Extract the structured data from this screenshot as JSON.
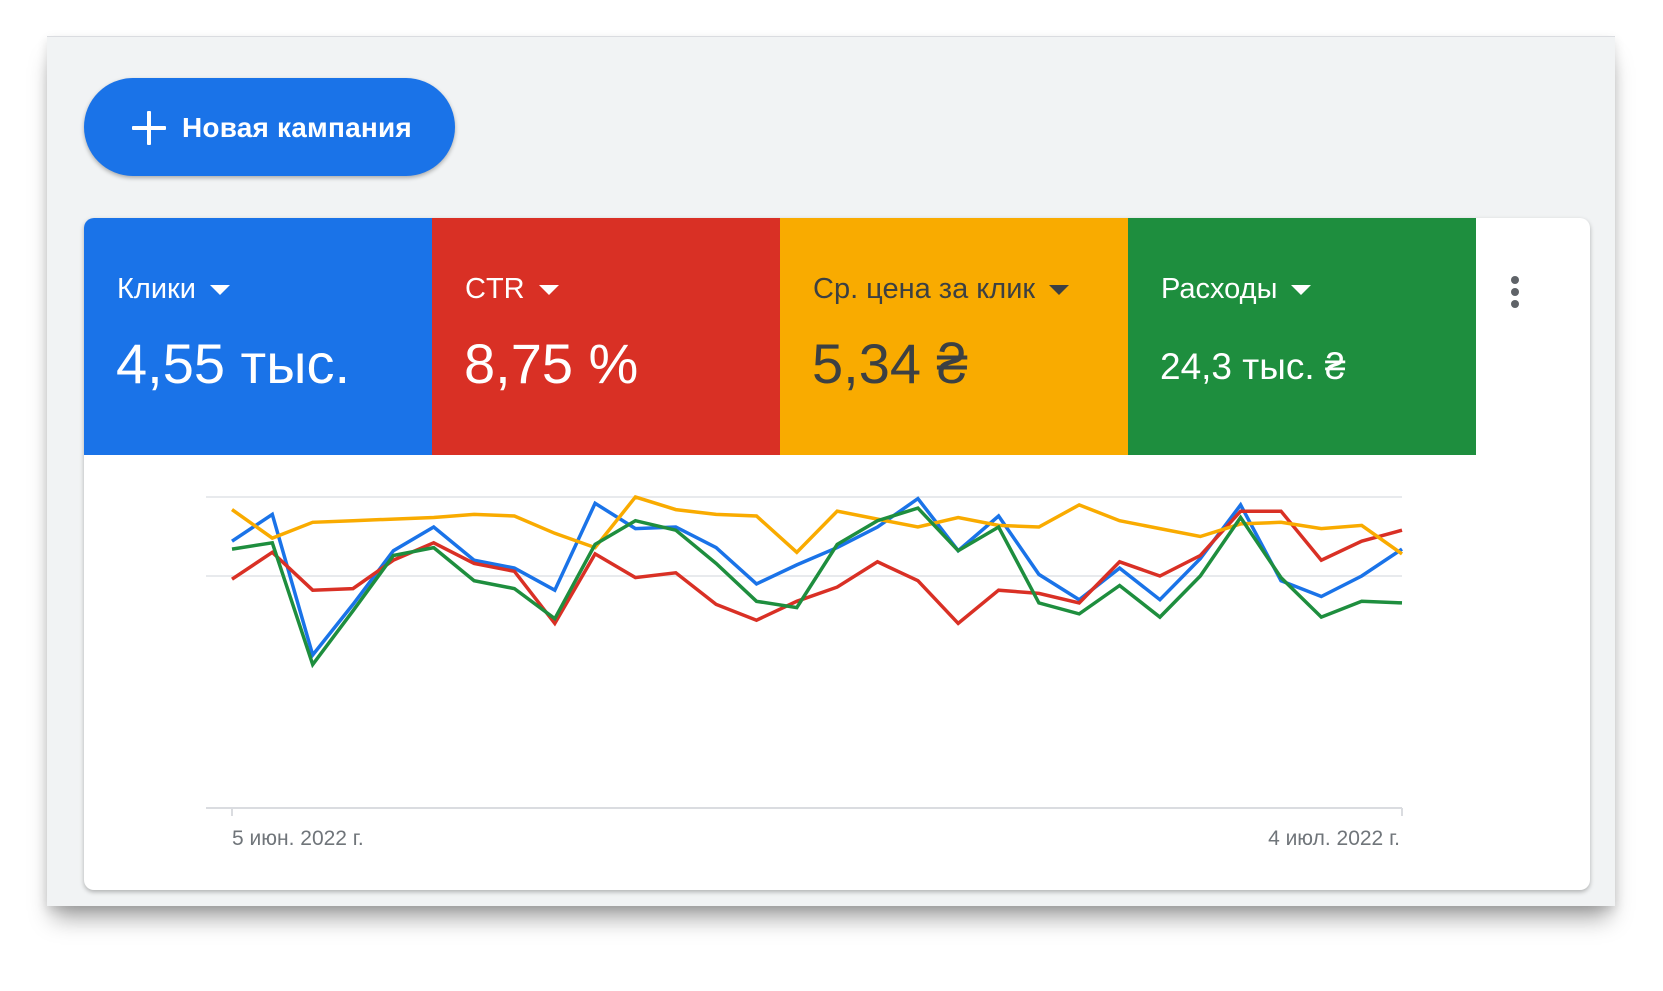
{
  "toolbar": {
    "new_campaign_label": "Новая кампания"
  },
  "metrics": [
    {
      "label": "Клики",
      "value": "4,55 тыс.",
      "color": "#1a73e8",
      "text_color": "#ffffff"
    },
    {
      "label": "CTR",
      "value": "8,75 %",
      "color": "#d93025",
      "text_color": "#ffffff"
    },
    {
      "label": "Ср. цена за клик",
      "value": "5,34 ₴",
      "color": "#f9ab00",
      "text_color": "#3c4043"
    },
    {
      "label": "Расходы",
      "value": "24,3 тыс. ₴",
      "color": "#1e8e3e",
      "text_color": "#ffffff"
    }
  ],
  "chart_data": {
    "type": "line",
    "x": [
      "5 июн. 2022 г.",
      "",
      "",
      "",
      "",
      "",
      "",
      "",
      "",
      "",
      "",
      "",
      "",
      "",
      "",
      "",
      "",
      "",
      "",
      "",
      "",
      "",
      "",
      "",
      "",
      "",
      "",
      "",
      "",
      "4 июл. 2022 г."
    ],
    "x_tick_labels": [
      "5 июн. 2022 г.",
      "4 июл. 2022 г."
    ],
    "y_scale": "relative",
    "ylim": [
      0,
      100
    ],
    "gridlines": [
      100,
      50
    ],
    "series": [
      {
        "color": "#1a73e8",
        "values": [
          72,
          89,
          0,
          32,
          66,
          81,
          60,
          55,
          41,
          96,
          80,
          81,
          68,
          45,
          57,
          68,
          81,
          99,
          66,
          88,
          51,
          35,
          55,
          35,
          61,
          95,
          47,
          37,
          50,
          67
        ]
      },
      {
        "color": "#d93025",
        "values": [
          48,
          65,
          41,
          42,
          60,
          71,
          58,
          53,
          20,
          64,
          49,
          52,
          32,
          22,
          34,
          43,
          59,
          47,
          20,
          41,
          39,
          33,
          59,
          50,
          63,
          91,
          91,
          60,
          72,
          79
        ]
      },
      {
        "color": "#f9ab00",
        "values": [
          92,
          74,
          84,
          85,
          86,
          87,
          89,
          88,
          77,
          68,
          100,
          92,
          89,
          88,
          65,
          91,
          86,
          81,
          87,
          82,
          81,
          95,
          85,
          80,
          75,
          83,
          84,
          80,
          82,
          64
        ]
      },
      {
        "color": "#1e8e3e",
        "values": [
          67,
          71,
          -6,
          28,
          63,
          68,
          47,
          42,
          23,
          70,
          85,
          79,
          58,
          34,
          30,
          70,
          85,
          93,
          66,
          81,
          33,
          26,
          44,
          24,
          50,
          87,
          49,
          24,
          34,
          33
        ]
      }
    ]
  }
}
